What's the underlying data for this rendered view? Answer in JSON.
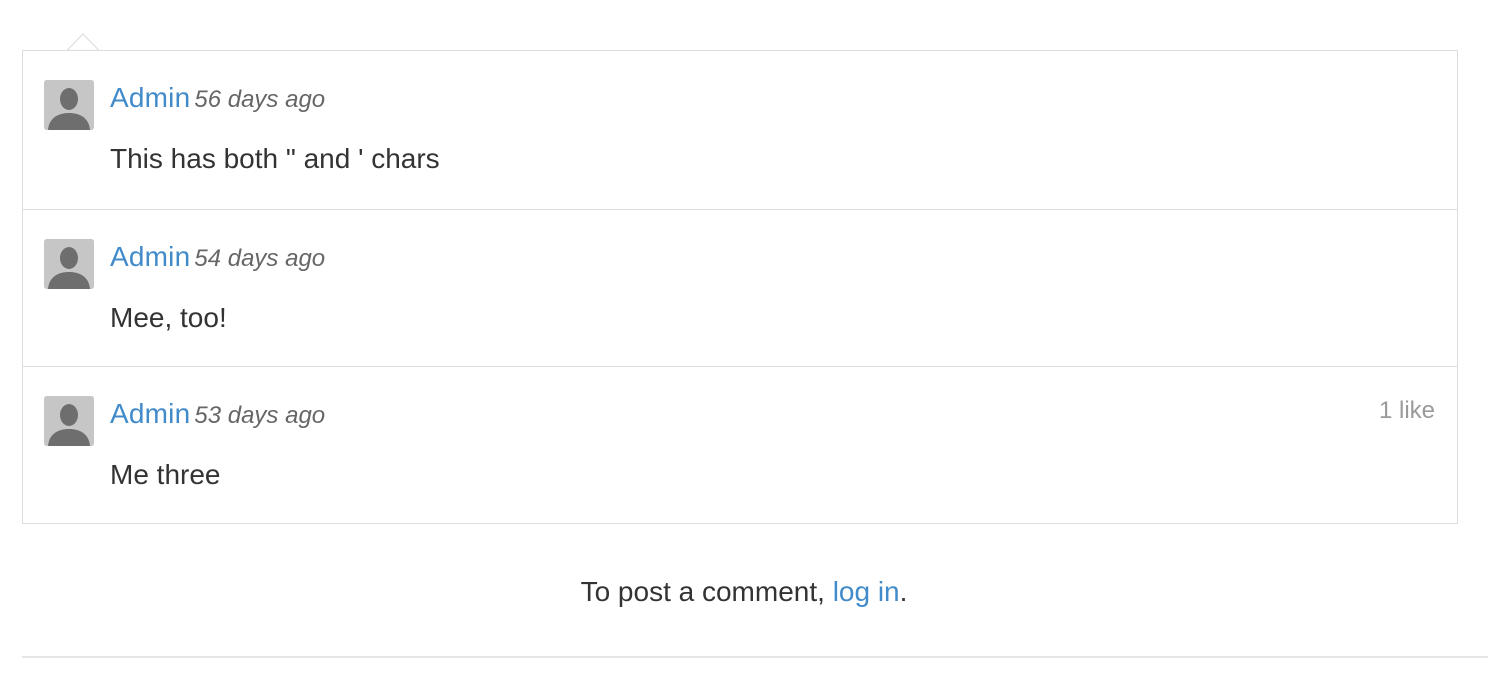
{
  "comments": [
    {
      "author": "Admin",
      "time": "56 days ago",
      "body": "This has both \" and ' chars",
      "likes": ""
    },
    {
      "author": "Admin",
      "time": "54 days ago",
      "body": "Mee, too!",
      "likes": ""
    },
    {
      "author": "Admin",
      "time": "53 days ago",
      "body": "Me three",
      "likes": "1 like"
    }
  ],
  "post_prompt": {
    "prefix": "To post a comment, ",
    "link": "log in",
    "suffix": "."
  },
  "icons": {
    "avatar": "default-user-silhouette-icon",
    "pointer": "caret-up-icon"
  },
  "colors": {
    "link": "#428bca",
    "text": "#333333",
    "muted": "#9a9a9a",
    "border": "#dedede"
  }
}
